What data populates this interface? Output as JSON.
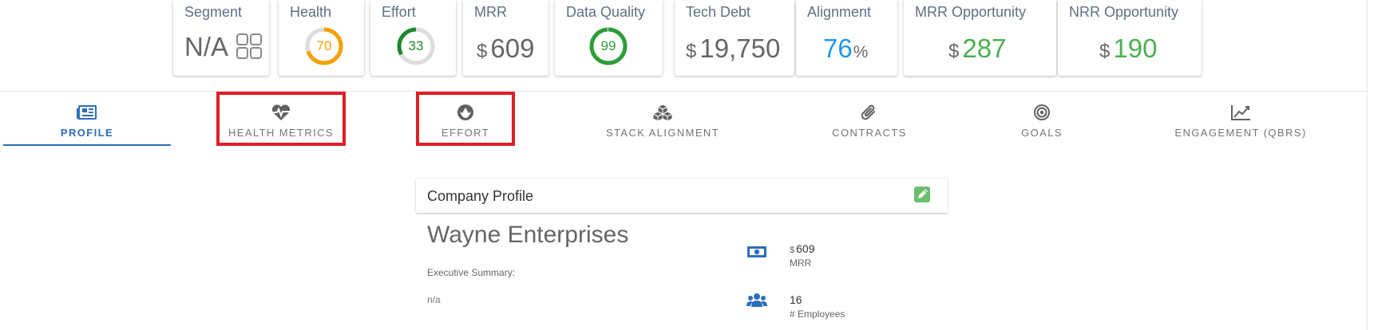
{
  "kpis": {
    "segment": {
      "title": "Segment",
      "value": "N/A"
    },
    "health": {
      "title": "Health",
      "value": "70",
      "ratio": 0.7,
      "color": "#f4a100"
    },
    "effort": {
      "title": "Effort",
      "value": "33",
      "ratio": 0.33,
      "color": "#1b8a2c"
    },
    "mrr": {
      "title": "MRR",
      "currency": "$",
      "value": "609"
    },
    "data_quality": {
      "title": "Data Quality",
      "value": "99",
      "ratio": 0.99,
      "color": "#2e9d3a"
    },
    "tech_debt": {
      "title": "Tech Debt",
      "currency": "$",
      "value": "19,750"
    },
    "alignment": {
      "title": "Alignment",
      "value": "76",
      "unit": "%"
    },
    "mrr_opportunity": {
      "title": "MRR Opportunity",
      "currency": "$",
      "value": "287"
    },
    "nrr_opportunity": {
      "title": "NRR Opportunity",
      "currency": "$",
      "value": "190"
    }
  },
  "tabs": [
    {
      "label": "PROFILE",
      "icon": "newspaper-icon",
      "active": true
    },
    {
      "label": "HEALTH METRICS",
      "icon": "heartbeat-icon",
      "highlighted": true
    },
    {
      "label": "EFFORT",
      "icon": "rebel-icon",
      "highlighted": true
    },
    {
      "label": "STACK ALIGNMENT",
      "icon": "cubes-icon"
    },
    {
      "label": "CONTRACTS",
      "icon": "paperclip-icon"
    },
    {
      "label": "GOALS",
      "icon": "bullseye-icon"
    },
    {
      "label": "ENGAGEMENT (QBRS)",
      "icon": "line-chart-icon"
    }
  ],
  "profile": {
    "title": "Company Profile",
    "company_name": "Wayne Enterprises",
    "executive_summary_label": "Executive Summary:",
    "executive_summary": "n/a",
    "stats": [
      {
        "icon": "money-bill-icon",
        "currency": "$",
        "value": "609",
        "label": "MRR"
      },
      {
        "icon": "users-icon",
        "value": "16",
        "label": "# Employees"
      }
    ]
  },
  "colors": {
    "accent": "#2c6fb8",
    "highlight": "#e01e25",
    "positive": "#4caf50",
    "alignment": "#2196f3",
    "edit": "#6bbf6e"
  }
}
